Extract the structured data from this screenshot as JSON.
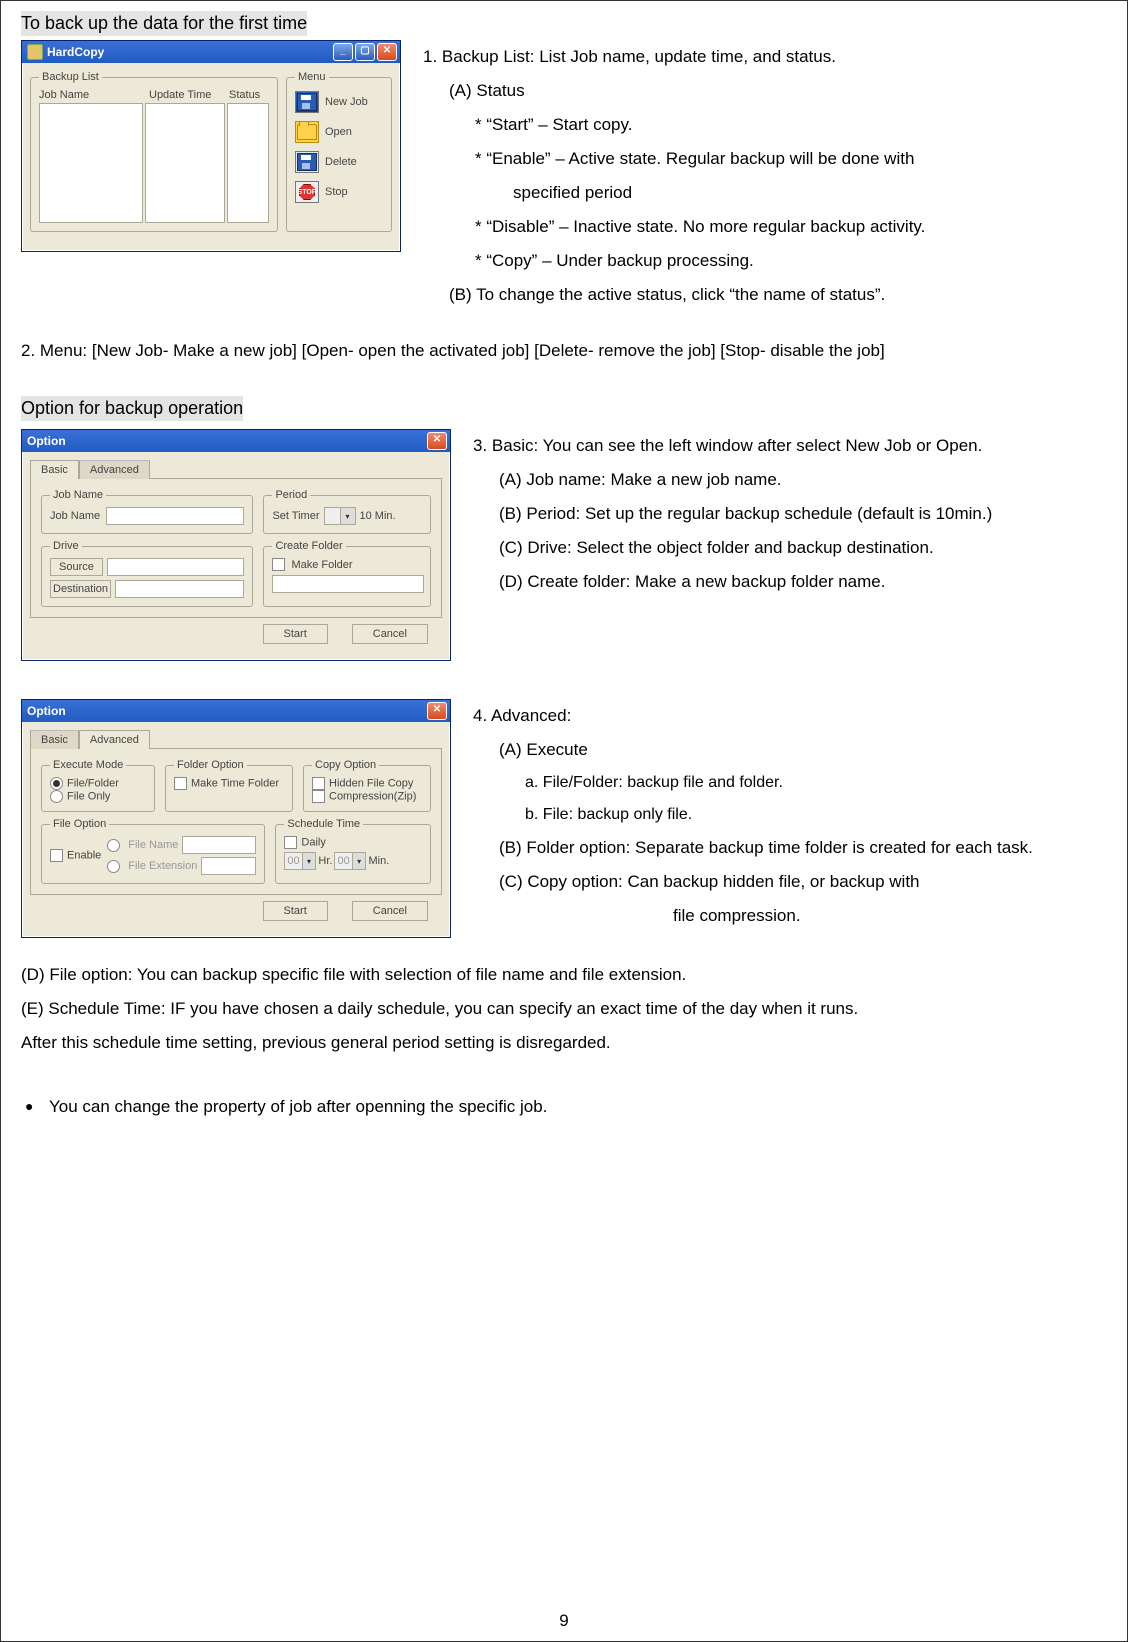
{
  "page_number": "9",
  "section1_title": "To back up the data for the first time",
  "hardcopy": {
    "title": "HardCopy",
    "backup_list_legend": "Backup List",
    "col_job": "Job Name",
    "col_update": "Update Time",
    "col_status": "Status",
    "menu_legend": "Menu",
    "menu_new": "New Job",
    "menu_open": "Open",
    "menu_delete": "Delete",
    "menu_stop": "Stop",
    "stop_glyph": "STOP"
  },
  "text1": {
    "line1": "1. Backup List: List Job name, update time, and status.",
    "lineA": "(A) Status",
    "s_start": "* “Start”     – Start copy.",
    "s_enable1": "* “Enable” – Active state. Regular backup will be done with",
    "s_enable2": "specified period",
    "s_disable": "* “Disable” – Inactive state. No more regular backup activity.",
    "s_copy": "* “Copy”    – Under backup processing.",
    "lineB": "(B) To change the active status, click “the name of status”."
  },
  "text2": "2. Menu: [New Job- Make a new job] [Open- open the activated job] [Delete- remove the job] [Stop- disable the job]",
  "section2_title": "Option for backup operation",
  "option": {
    "title": "Option",
    "tab_basic": "Basic",
    "tab_adv": "Advanced",
    "jobname_legend": "Job Name",
    "jobname_label": "Job Name",
    "drive_legend": "Drive",
    "src_btn": "Source",
    "dst_btn": "Destination",
    "period_legend": "Period",
    "period_label": "Set Timer",
    "period_val": "10 Min.",
    "create_legend": "Create Folder",
    "create_cb": "Make Folder",
    "btn_start": "Start",
    "btn_cancel": "Cancel"
  },
  "text3": {
    "l1": "3. Basic: You can see the left window after select New Job or Open.",
    "la": "(A) Job name: Make a new job name.",
    "lb": "(B) Period: Set up the regular backup schedule (default is 10min.)",
    "lc": "(C) Drive: Select the object folder and backup destination.",
    "ld": "(D) Create folder: Make a new backup folder name."
  },
  "adv": {
    "exec_legend": "Execute Mode",
    "exec_ff": "File/Folder",
    "exec_f": "File Only",
    "folder_legend": "Folder Option",
    "folder_cb": "Make Time Folder",
    "copy_legend": "Copy Option",
    "copy_hidden": "Hidden File Copy",
    "copy_zip": "Compression(Zip)",
    "file_legend": "File Option",
    "file_enable": "Enable",
    "file_name_r": "File Name",
    "file_ext_r": "File Extension",
    "sched_legend": "Schedule Time",
    "sched_daily": "Daily",
    "sched_hr": "Hr.",
    "sched_min": "Min.",
    "sched_00": "00"
  },
  "text4": {
    "l1": "4. Advanced:",
    "la": "(A) Execute",
    "laa": "a. File/Folder: backup file and folder.",
    "lab": "b. File: backup only file.",
    "lb": "(B) Folder option: Separate backup time folder is created for each task.",
    "lc": "(C) Copy option: Can backup hidden file, or backup with",
    "lc2": "file compression.",
    "ld": "(D) File option: You can backup specific file with selection of file name and file extension.",
    "le": "(E) Schedule Time: IF you have chosen a daily schedule, you can specify an exact time of the day when it runs.",
    "lf": "After this schedule time setting, previous general period setting is disregarded."
  },
  "bullet_text": "You can change the property of job after openning the specific job."
}
